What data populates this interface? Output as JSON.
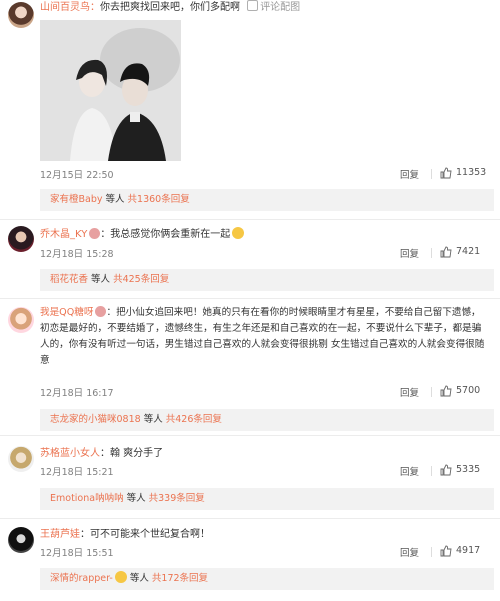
{
  "comments": [
    {
      "user": "山间百灵鸟：",
      "text": "你去把爽找回来吧，你们多配啊",
      "extra": "评论配图",
      "time": "12月15日 22:50",
      "reply_label": "回复",
      "likes": "11353",
      "reply_summary": {
        "names": "家有橙Baby",
        "mid": " 等人 ",
        "count": "共1360条回复"
      }
    },
    {
      "user": "乔木晶_KY",
      "text": "：我总感觉你俩会重新在一起",
      "time": "12月18日 15:28",
      "reply_label": "回复",
      "likes": "7421",
      "reply_summary": {
        "names": "稻花花香",
        "mid": " 等人 ",
        "count": "共425条回复"
      }
    },
    {
      "user": "我是QQ糖呀",
      "text": "：把小仙女追回来吧！她真的只有在看你的时候眼睛里才有星星，不要给自己留下遗憾，初恋是最好的，不要结婚了，遗憾终生，有生之年还是和自己喜欢的在一起，不要说什么下辈子，都是骗人的，你有没有听过一句话，男生错过自己喜欢的人就会变得很挑剔 女生错过自己喜欢的人就会变得很随意",
      "time": "12月18日 16:17",
      "reply_label": "回复",
      "likes": "5700",
      "reply_summary": {
        "names": "志龙家的小猫咪0818",
        "mid": " 等人 ",
        "count": "共426条回复"
      }
    },
    {
      "user": "苏格蓝小女人",
      "text": "：翰 爽分手了",
      "time": "12月18日 15:21",
      "reply_label": "回复",
      "likes": "5335",
      "reply_summary": {
        "names": "Emotiona呐呐呐",
        "mid": " 等人 ",
        "count": "共339条回复"
      }
    },
    {
      "user": "王葫芦娃",
      "text": "：可不可能来个世纪复合啊！",
      "time": "12月18日 15:51",
      "reply_label": "回复",
      "likes": "4917",
      "reply_summary": {
        "names": "深情的rapper-",
        "mid": " 等人 ",
        "count": "共172条回复"
      }
    }
  ],
  "colors": {
    "accent": "#eb7350",
    "reply_bg": "#f2f2f2"
  },
  "icons": [
    "avatar",
    "thumbs-up-icon",
    "edit-icon",
    "emoji-icon"
  ]
}
